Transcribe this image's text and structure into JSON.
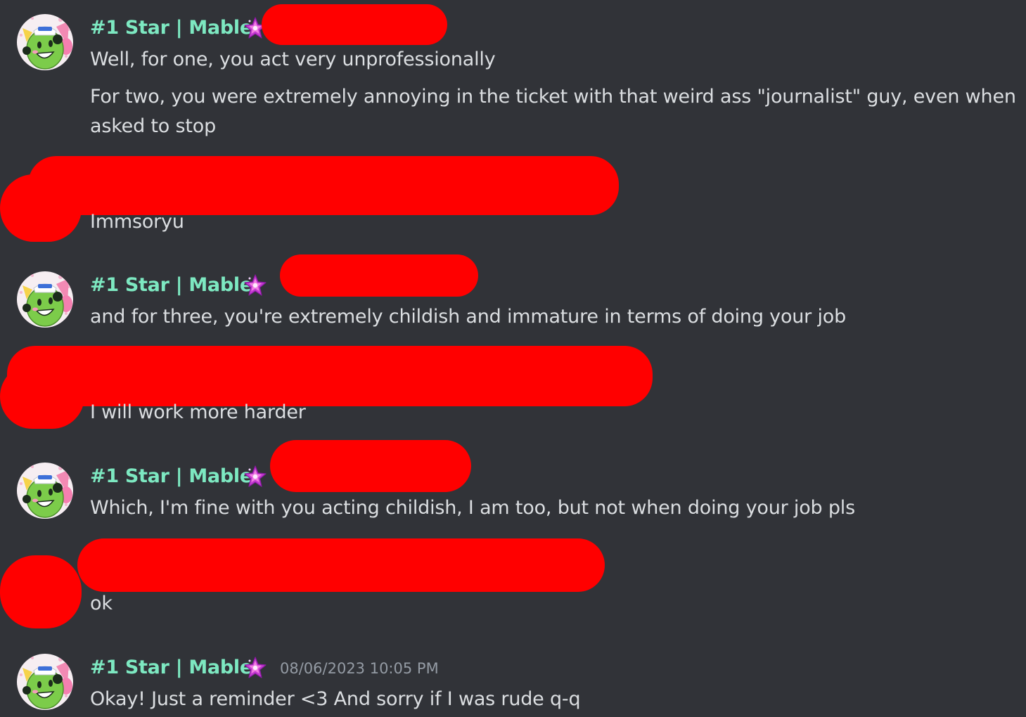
{
  "author": {
    "name": "#1 Star | Mable",
    "role_icon": "star-role-icon"
  },
  "colors": {
    "background": "#313338",
    "username": "#7de8c1",
    "message_text": "#dbdee1",
    "timestamp": "#949ba4",
    "redaction": "#ff0000",
    "role_icon": "#e03ad0"
  },
  "messages": [
    {
      "lines": [
        "Well, for one, you act very unprofessionally",
        "For two, you were extremely annoying in the ticket with that weird ass \"journalist\" guy, even when asked to stop"
      ]
    },
    {
      "text": "Immsoryu"
    },
    {
      "text": "and for three, you're extremely childish and immature in terms of doing your job"
    },
    {
      "text": "I will work more harder"
    },
    {
      "text": "Which, I'm fine with you acting childish, I am too, but not when doing your job pls"
    },
    {
      "text": "ok"
    },
    {
      "timestamp": "08/06/2023 10:05 PM",
      "text": "Okay! Just a reminder <3 And sorry if I was rude q-q"
    }
  ]
}
